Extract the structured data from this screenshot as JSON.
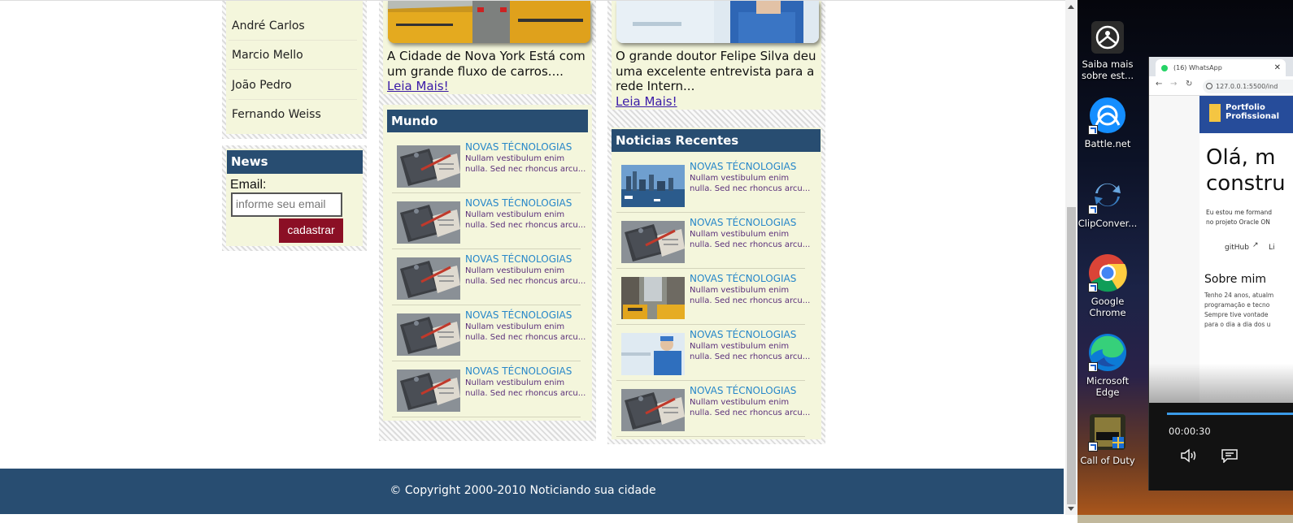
{
  "sidebar": {
    "names": [
      "André Carlos",
      "Marcio Mello",
      "João Pedro",
      "Fernando Weiss"
    ],
    "news_header": "News",
    "email_label": "Email:",
    "email_placeholder": "informe seu email",
    "submit_label": "cadastrar"
  },
  "featured": [
    {
      "text": "A Cidade de Nova York Está com um grande fluxo de carros....",
      "link": "Leia Mais!"
    },
    {
      "text": "O grande doutor Felipe Silva deu uma excelente entrevista para a rede Intern...",
      "link": "Leia Mais!"
    }
  ],
  "mundo": {
    "header": "Mundo",
    "items": [
      {
        "title": "NOVAS TÉCNOLOGIAS",
        "desc": "Nullam vestibulum enim nulla. Sed nec rhoncus arcu...",
        "thumb": "notebook"
      },
      {
        "title": "NOVAS TÉCNOLOGIAS",
        "desc": "Nullam vestibulum enim nulla. Sed nec rhoncus arcu...",
        "thumb": "notebook"
      },
      {
        "title": "NOVAS TÉCNOLOGIAS",
        "desc": "Nullam vestibulum enim nulla. Sed nec rhoncus arcu...",
        "thumb": "notebook"
      },
      {
        "title": "NOVAS TÉCNOLOGIAS",
        "desc": "Nullam vestibulum enim nulla. Sed nec rhoncus arcu...",
        "thumb": "notebook"
      },
      {
        "title": "NOVAS TÉCNOLOGIAS",
        "desc": "Nullam vestibulum enim nulla. Sed nec rhoncus arcu...",
        "thumb": "notebook"
      }
    ]
  },
  "recentes": {
    "header": "Noticias Recentes",
    "items": [
      {
        "title": "NOVAS TÉCNOLOGIAS",
        "desc": "Nullam vestibulum enim nulla. Sed nec rhoncus arcu...",
        "thumb": "skyline"
      },
      {
        "title": "NOVAS TÉCNOLOGIAS",
        "desc": "Nullam vestibulum enim nulla. Sed nec rhoncus arcu...",
        "thumb": "notebook"
      },
      {
        "title": "NOVAS TÉCNOLOGIAS",
        "desc": "Nullam vestibulum enim nulla. Sed nec rhoncus arcu...",
        "thumb": "taxi"
      },
      {
        "title": "NOVAS TÉCNOLOGIAS",
        "desc": "Nullam vestibulum enim nulla. Sed nec rhoncus arcu...",
        "thumb": "doctor"
      },
      {
        "title": "NOVAS TÉCNOLOGIAS",
        "desc": "Nullam vestibulum enim nulla. Sed nec rhoncus arcu...",
        "thumb": "notebook"
      }
    ]
  },
  "footer": {
    "text": "© Copyright 2000-2010 Noticiando sua cidade"
  },
  "desktop": {
    "icons": [
      {
        "label": "Saiba mais sobre est...",
        "icon": "info-camera-icon"
      },
      {
        "label": "Battle.net",
        "icon": "battlenet-icon"
      },
      {
        "label": "ClipConver...",
        "icon": "clipconverter-icon"
      },
      {
        "label": "Google Chrome",
        "icon": "chrome-icon"
      },
      {
        "label": "Microsoft Edge",
        "icon": "edge-icon"
      },
      {
        "label": "Call of Duty",
        "icon": "call-of-duty-icon"
      }
    ]
  },
  "floating_window": {
    "tab_title": "(16) WhatsApp",
    "url": "127.0.0.1:5500/ind",
    "brand": "Portfolio Profissional",
    "heading_1": "Olá, m",
    "heading_2": "constru",
    "intro_1": "Eu estou me formand",
    "intro_2": "no projeto Oracle ON",
    "github": "gitHub",
    "linkedin": "Li",
    "about_title": "Sobre mim",
    "about_1": "Tenho 24 anos, atualm",
    "about_2": "programação e tecno",
    "about_3": "Sempre tive vontade",
    "about_4": "para o dia a dia dos u",
    "time": "00:00:30"
  },
  "colors": {
    "header_blue": "#284d71",
    "panel_bg": "#f4f6dc",
    "news_title": "#2787c9",
    "news_desc": "#5a2f7a",
    "link": "#3a1aa8",
    "button": "#8b0f25"
  }
}
